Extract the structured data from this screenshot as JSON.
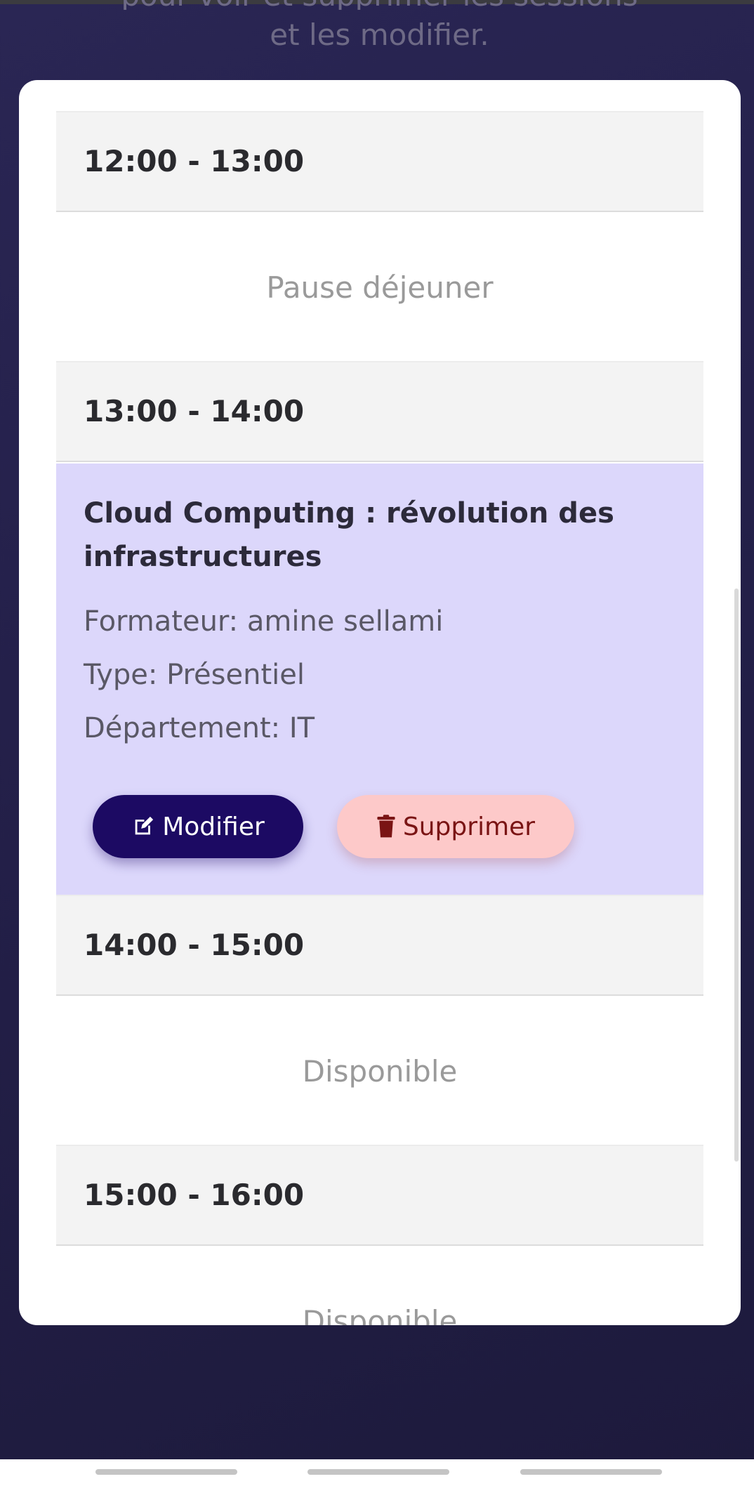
{
  "header": {
    "subtitle_partial": "et les modifier.",
    "subtitle_clipped": "pour voir et supprimer les sessions"
  },
  "schedule": {
    "slots": [
      {
        "time": "12:00 - 13:00",
        "status": "Pause déjeuner"
      },
      {
        "time": "13:00 - 14:00"
      },
      {
        "time": "14:00 - 15:00",
        "status": "Disponible"
      },
      {
        "time": "15:00 - 16:00",
        "status": "Disponible"
      }
    ],
    "session": {
      "title": "Cloud Computing : révolution des infrastructures",
      "trainer": "Formateur: amine sellami",
      "type": "Type: Présentiel",
      "department": "Département: IT",
      "edit_label": "Modifier",
      "delete_label": "Supprimer",
      "edit_icon": "edit-icon",
      "delete_icon": "trash-icon"
    }
  },
  "colors": {
    "session_bg": "#dcd7fb",
    "edit_button": "#1c0a63",
    "delete_button": "#fdc9c9"
  }
}
